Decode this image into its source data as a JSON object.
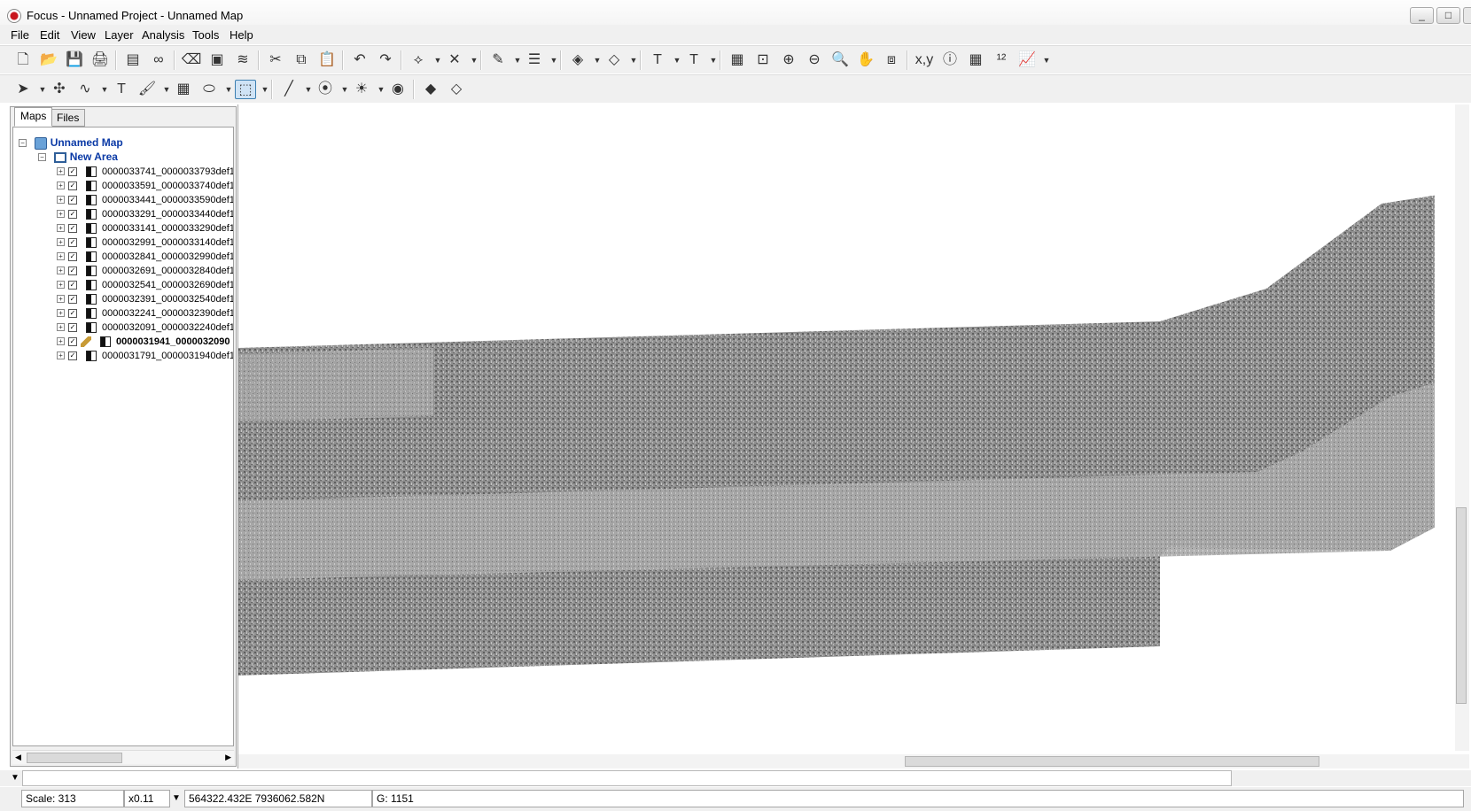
{
  "window": {
    "title": "Focus - Unnamed Project - Unnamed Map",
    "controls": [
      "_",
      "□",
      "✕"
    ]
  },
  "menu": [
    "File",
    "Edit",
    "View",
    "Layer",
    "Analysis",
    "Tools",
    "Help"
  ],
  "panel": {
    "tabs": [
      "Maps",
      "Files"
    ],
    "root": "Unnamed Map",
    "area": "New Area",
    "layers": [
      {
        "label": "0000033741_0000033793def1",
        "selected": false
      },
      {
        "label": "0000033591_0000033740def1",
        "selected": false
      },
      {
        "label": "0000033441_0000033590def1",
        "selected": false
      },
      {
        "label": "0000033291_0000033440def1",
        "selected": false
      },
      {
        "label": "0000033141_0000033290def1",
        "selected": false
      },
      {
        "label": "0000032991_0000033140def1",
        "selected": false
      },
      {
        "label": "0000032841_0000032990def1",
        "selected": false
      },
      {
        "label": "0000032691_0000032840def1",
        "selected": false
      },
      {
        "label": "0000032541_0000032690def1",
        "selected": false
      },
      {
        "label": "0000032391_0000032540def1",
        "selected": false
      },
      {
        "label": "0000032241_0000032390def1",
        "selected": false
      },
      {
        "label": "0000032091_0000032240def1",
        "selected": false
      },
      {
        "label": "0000031941_0000032090",
        "selected": true
      },
      {
        "label": "0000031791_0000031940def1",
        "selected": false
      }
    ]
  },
  "toolbar1": [
    {
      "name": "new-file-icon",
      "glyph": "🗋"
    },
    {
      "name": "open-folder-icon",
      "glyph": "📂"
    },
    {
      "name": "save-icon",
      "glyph": "💾"
    },
    {
      "name": "print-icon",
      "glyph": "🖨"
    },
    {
      "name": "sep"
    },
    {
      "name": "properties-icon",
      "glyph": "▤"
    },
    {
      "name": "link-icon",
      "glyph": "∞"
    },
    {
      "name": "sep"
    },
    {
      "name": "eraser-icon",
      "glyph": "⌫"
    },
    {
      "name": "window-icon",
      "glyph": "▣"
    },
    {
      "name": "layers-icon",
      "glyph": "≋"
    },
    {
      "name": "sep"
    },
    {
      "name": "cut-icon",
      "glyph": "✂"
    },
    {
      "name": "copy-icon",
      "glyph": "⧉"
    },
    {
      "name": "paste-icon",
      "glyph": "📋"
    },
    {
      "name": "sep"
    },
    {
      "name": "undo-icon",
      "glyph": "↶"
    },
    {
      "name": "redo-icon",
      "glyph": "↷"
    },
    {
      "name": "sep"
    },
    {
      "name": "vertex-add-icon",
      "glyph": "⟡"
    },
    {
      "name": "caret"
    },
    {
      "name": "vertex-remove-icon",
      "glyph": "✕"
    },
    {
      "name": "caret"
    },
    {
      "name": "sep"
    },
    {
      "name": "line-color-icon",
      "glyph": "✎"
    },
    {
      "name": "caret"
    },
    {
      "name": "line-style-icon",
      "glyph": "☰"
    },
    {
      "name": "caret"
    },
    {
      "name": "sep"
    },
    {
      "name": "fill-color-icon",
      "glyph": "◈"
    },
    {
      "name": "caret"
    },
    {
      "name": "fill-style-icon",
      "glyph": "◇"
    },
    {
      "name": "caret"
    },
    {
      "name": "sep"
    },
    {
      "name": "text-color-icon",
      "glyph": "T"
    },
    {
      "name": "caret"
    },
    {
      "name": "text-style-icon",
      "glyph": "T"
    },
    {
      "name": "caret"
    },
    {
      "name": "sep"
    },
    {
      "name": "zoom-extents-icon",
      "glyph": "▦"
    },
    {
      "name": "zoom-window-icon",
      "glyph": "⊡"
    },
    {
      "name": "zoom-in-icon",
      "glyph": "⊕"
    },
    {
      "name": "zoom-out-icon",
      "glyph": "⊖"
    },
    {
      "name": "zoom-select-icon",
      "glyph": "🔍"
    },
    {
      "name": "pan-icon",
      "glyph": "✋"
    },
    {
      "name": "zoom-previous-icon",
      "glyph": "⧈"
    },
    {
      "name": "sep"
    },
    {
      "name": "coordinates-icon",
      "glyph": "x,y"
    },
    {
      "name": "info-icon",
      "glyph": "ⓘ"
    },
    {
      "name": "table-icon",
      "glyph": "▦"
    },
    {
      "name": "numbers-icon",
      "glyph": "¹²"
    },
    {
      "name": "chart-icon",
      "glyph": "📈"
    },
    {
      "name": "caret"
    }
  ],
  "toolbar2": [
    {
      "name": "select-arrow-icon",
      "glyph": "➤"
    },
    {
      "name": "caret"
    },
    {
      "name": "edit-vertex-icon",
      "glyph": "✣"
    },
    {
      "name": "polyline-icon",
      "glyph": "∿"
    },
    {
      "name": "caret"
    },
    {
      "name": "text-tool-icon",
      "glyph": "T"
    },
    {
      "name": "paint-icon",
      "glyph": "🖌"
    },
    {
      "name": "caret"
    },
    {
      "name": "grid-icon",
      "glyph": "▦"
    },
    {
      "name": "fill-tool-icon",
      "glyph": "⬭"
    },
    {
      "name": "caret"
    },
    {
      "name": "select-region-icon",
      "glyph": "⬚",
      "active": true
    },
    {
      "name": "caret"
    },
    {
      "name": "sep"
    },
    {
      "name": "draw-line-icon",
      "glyph": "╱"
    },
    {
      "name": "caret"
    },
    {
      "name": "contour-icon",
      "glyph": "⦿"
    },
    {
      "name": "caret"
    },
    {
      "name": "light-source-icon",
      "glyph": "☀"
    },
    {
      "name": "caret"
    },
    {
      "name": "rgb-icon",
      "glyph": "◉"
    },
    {
      "name": "sep"
    },
    {
      "name": "layer-stack-icon",
      "glyph": "◆"
    },
    {
      "name": "layer-stack-2-icon",
      "glyph": "◇"
    }
  ],
  "status": {
    "scale": "Scale: 313",
    "zoom": "x0.11",
    "coords": "564322.432E 7936062.582N",
    "grid": "G: 1151"
  }
}
